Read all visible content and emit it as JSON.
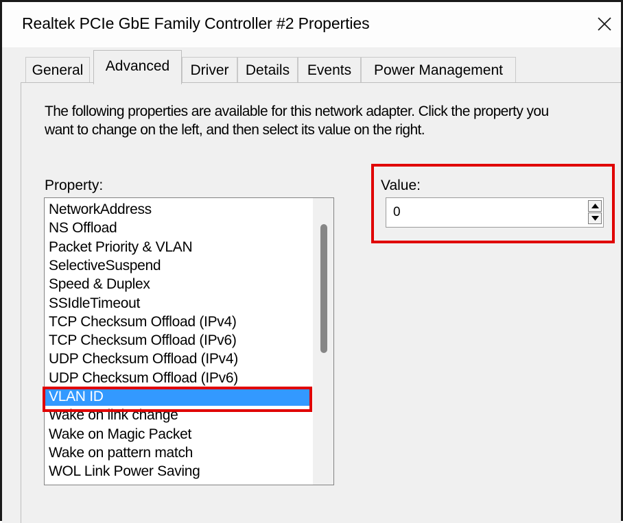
{
  "window": {
    "title": "Realtek PCIe GbE Family Controller #2 Properties",
    "close_icon": "close-icon"
  },
  "tabs": [
    {
      "label": "General",
      "active": false
    },
    {
      "label": "Advanced",
      "active": true
    },
    {
      "label": "Driver",
      "active": false
    },
    {
      "label": "Details",
      "active": false
    },
    {
      "label": "Events",
      "active": false
    },
    {
      "label": "Power Management",
      "active": false
    }
  ],
  "advanced": {
    "description": "The following properties are available for this network adapter. Click the property you want to change on the left, and then select its value on the right.",
    "property_label": "Property:",
    "value_label": "Value:",
    "value": "0",
    "properties": [
      "NetworkAddress",
      "NS Offload",
      "Packet Priority & VLAN",
      "SelectiveSuspend",
      "Speed & Duplex",
      "SSIdleTimeout",
      "TCP Checksum Offload (IPv4)",
      "TCP Checksum Offload (IPv6)",
      "UDP Checksum Offload (IPv4)",
      "UDP Checksum Offload (IPv6)",
      "VLAN ID",
      "Wake on link change",
      "Wake on Magic Packet",
      "Wake on pattern match",
      "WOL Link Power Saving"
    ],
    "selected_property": "VLAN ID"
  },
  "colors": {
    "selection": "#3399ff",
    "highlight_border": "#e00000",
    "dialog_bg": "#f0f0f0"
  }
}
